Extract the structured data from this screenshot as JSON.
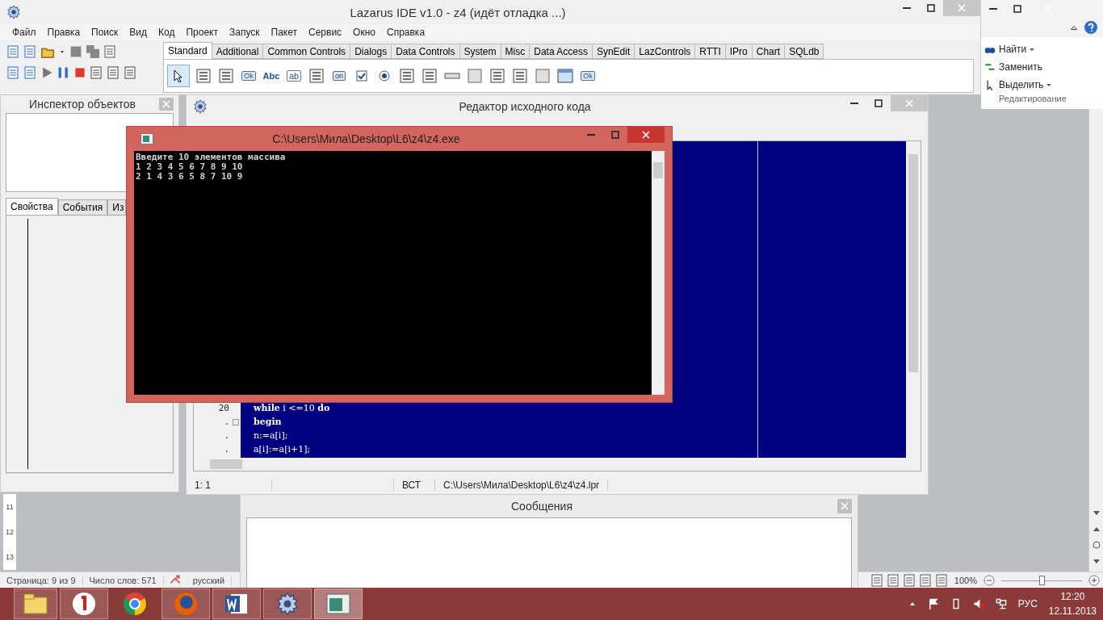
{
  "word": {
    "ribbon_items": [
      {
        "kind": "find",
        "label": "Найти",
        "dropdown": true
      },
      {
        "kind": "replace",
        "label": "Заменить",
        "dropdown": false
      },
      {
        "kind": "select",
        "label": "Выделить",
        "dropdown": true
      }
    ],
    "ribbon_group": "Редактирование",
    "ruler": [
      "11",
      "12",
      "13"
    ],
    "status": {
      "page": "Страница: 9 из 9",
      "words": "Число слов: 571",
      "language": "русский",
      "zoom": "100%",
      "zoom_slider": {
        "level": 0.5
      }
    }
  },
  "lazarus": {
    "title": "Lazarus IDE v1.0 - z4 (идёт отладка ...)",
    "menu": [
      "Файл",
      "Правка",
      "Поиск",
      "Вид",
      "Код",
      "Проект",
      "Запуск",
      "Пакет",
      "Сервис",
      "Окно",
      "Справка"
    ],
    "palette_tabs": [
      {
        "label": "Standard",
        "selected": true
      },
      {
        "label": "Additional",
        "selected": false
      },
      {
        "label": "Common Controls",
        "selected": false
      },
      {
        "label": "Dialogs",
        "selected": false
      },
      {
        "label": "Data Controls",
        "selected": false
      },
      {
        "label": "System",
        "selected": false
      },
      {
        "label": "Misc",
        "selected": false
      },
      {
        "label": "Data Access",
        "selected": false
      },
      {
        "label": "SynEdit",
        "selected": false
      },
      {
        "label": "LazControls",
        "selected": false
      },
      {
        "label": "RTTI",
        "selected": false
      },
      {
        "label": "IPro",
        "selected": false
      },
      {
        "label": "Chart",
        "selected": false
      },
      {
        "label": "SQLdb",
        "selected": false
      }
    ],
    "palette_icons": [
      {
        "kind": "pointer",
        "selected": true
      },
      {
        "kind": "menu",
        "selected": false
      },
      {
        "kind": "popup",
        "selected": false
      },
      {
        "kind": "button",
        "label": "Ok",
        "selected": false
      },
      {
        "kind": "label",
        "label": "Abc",
        "selected": false
      },
      {
        "kind": "edit",
        "label": "ab",
        "selected": false
      },
      {
        "kind": "memo",
        "selected": false
      },
      {
        "kind": "toggle",
        "label": "on",
        "selected": false
      },
      {
        "kind": "checkbox",
        "selected": false
      },
      {
        "kind": "radio",
        "selected": false
      },
      {
        "kind": "list",
        "selected": false
      },
      {
        "kind": "list",
        "selected": false
      },
      {
        "kind": "scrollbar",
        "selected": false
      },
      {
        "kind": "panel",
        "selected": false
      },
      {
        "kind": "list",
        "selected": false
      },
      {
        "kind": "checklist",
        "selected": false
      },
      {
        "kind": "panel",
        "selected": false
      },
      {
        "kind": "form",
        "selected": false
      },
      {
        "kind": "button",
        "label": "Ok",
        "selected": false
      }
    ]
  },
  "inspector": {
    "title": "Инспектор объектов",
    "tabs": [
      {
        "label": "Свойства",
        "selected": true
      },
      {
        "label": "События",
        "selected": false
      },
      {
        "label": "Из",
        "selected": false
      }
    ]
  },
  "editor": {
    "title": "Редактор исходного кода",
    "lines": [
      {
        "number": "20",
        "text": "**while** i <=10 **do**",
        "kind": "code",
        "fold": false
      },
      {
        "number": ".",
        "text": "begin",
        "kind": "keyword",
        "fold": true
      },
      {
        "number": ".",
        "text": "n:=a[i];",
        "kind": "code",
        "fold": false
      },
      {
        "number": ".",
        "text": "a[i]:=a[i+1];",
        "kind": "code",
        "fold": false
      }
    ],
    "status": {
      "position": "1: 1",
      "mode": "ВСТ",
      "path": "C:\\Users\\Мила\\Desktop\\L6\\z4\\z4.lpr"
    }
  },
  "messages": {
    "title": "Сообщения"
  },
  "console": {
    "title": "C:\\Users\\Мила\\Desktop\\L6\\z4\\z4.exe",
    "lines": [
      "Введите 10 элементов массива",
      "1 2 3 4 5 6 7 8 9 10",
      "2 1 4 3 6 5 8 7 10 9"
    ]
  },
  "taskbar": {
    "apps": [
      {
        "kind": "folder",
        "running": true,
        "selected": false
      },
      {
        "kind": "yandex",
        "running": true,
        "selected": false
      },
      {
        "kind": "chrome",
        "running": false,
        "selected": false
      },
      {
        "kind": "firefox",
        "running": true,
        "selected": false
      },
      {
        "kind": "word",
        "running": true,
        "selected": false
      },
      {
        "kind": "gear",
        "running": true,
        "selected": false
      },
      {
        "kind": "console",
        "running": true,
        "selected": true
      }
    ],
    "language": "РУС",
    "time": "12:20",
    "date": "12.11.2013"
  }
}
